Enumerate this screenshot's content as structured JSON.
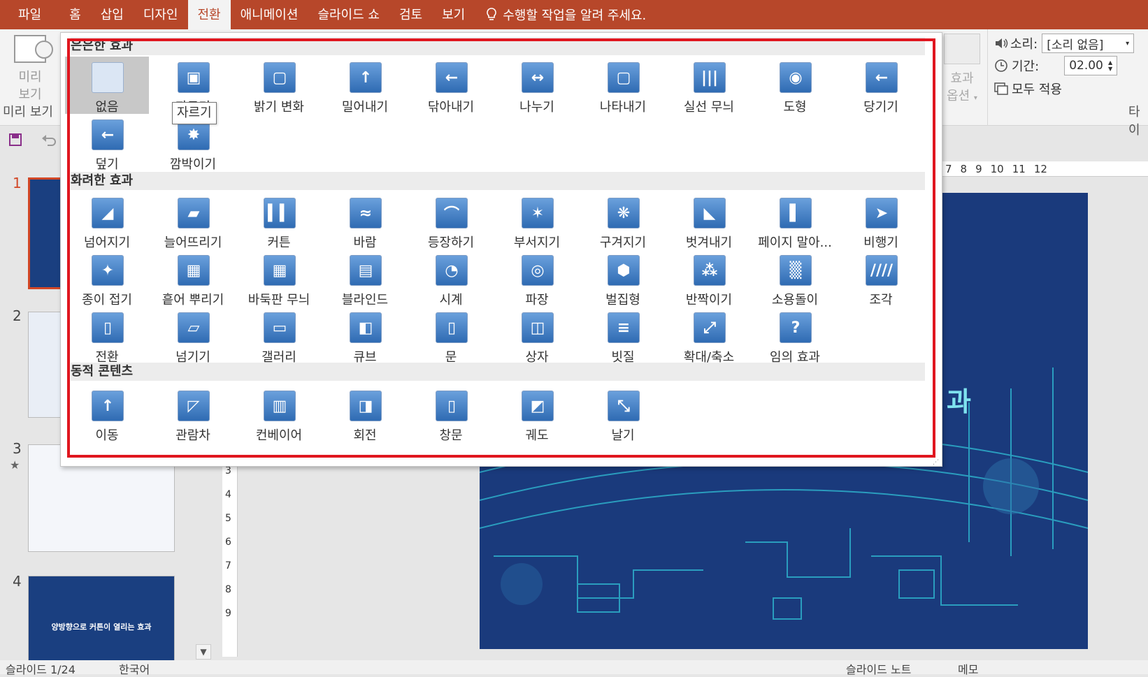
{
  "menubar": {
    "file": "파일",
    "tabs": [
      "홈",
      "삽입",
      "디자인",
      "전환",
      "애니메이션",
      "슬라이드 쇼",
      "검토",
      "보기"
    ],
    "active_tab_index": 3,
    "tell_me": "수행할 작업을 알려 주세요."
  },
  "ribbon": {
    "preview_label_line1": "미리",
    "preview_label_line2": "보기",
    "preview_group": "미리 보기",
    "effect_options_line1": "효과",
    "effect_options_line2": "옵션",
    "sound_label": "소리:",
    "sound_value": "[소리 없음]",
    "duration_label": "기간:",
    "duration_value": "02.00",
    "apply_all": "모두 적용",
    "timing_group_partial": "타이"
  },
  "gallery": {
    "sections": [
      {
        "title": "은은한 효과",
        "items": [
          "없음",
          "자르기",
          "밝기 변화",
          "밀어내기",
          "닦아내기",
          "나누기",
          "나타내기",
          "실선 무늬",
          "도형",
          "당기기",
          "덮기",
          "깜박이기"
        ]
      },
      {
        "title": "화려한 효과",
        "items": [
          "넘어지기",
          "늘어뜨리기",
          "커튼",
          "바람",
          "등장하기",
          "부서지기",
          "구겨지기",
          "벗겨내기",
          "페이지 말아...",
          "비행기",
          "종이 접기",
          "흩어 뿌리기",
          "바둑판 무늬",
          "블라인드",
          "시계",
          "파장",
          "벌집형",
          "반짝이기",
          "소용돌이",
          "조각",
          "전환",
          "넘기기",
          "갤러리",
          "큐브",
          "문",
          "상자",
          "빗질",
          "확대/축소",
          "임의 효과"
        ]
      },
      {
        "title": "동적 콘텐츠",
        "items": [
          "이동",
          "관람차",
          "컨베이어",
          "회전",
          "창문",
          "궤도",
          "날기"
        ]
      }
    ],
    "tooltip": "자르기",
    "selected_item": "없음"
  },
  "thumbnails": {
    "numbers": [
      "1",
      "2",
      "3",
      "4"
    ],
    "slide4_text": "양방향으로 커튼이 열리는 효과"
  },
  "slide": {
    "visible_text": "과"
  },
  "rulers": {
    "horizontal": [
      "7",
      "8",
      "9",
      "10",
      "11",
      "12"
    ],
    "vertical": [
      "3",
      "4",
      "5",
      "6",
      "7",
      "8",
      "9"
    ]
  },
  "statusbar": {
    "slide_info": "슬라이드 1/24",
    "language": "한국어",
    "notes": "슬라이드 노트",
    "comments": "메모"
  },
  "colors": {
    "accent": "#b7472a",
    "selection_frame": "#e0161f",
    "slide_bg": "#1a3a7c"
  }
}
